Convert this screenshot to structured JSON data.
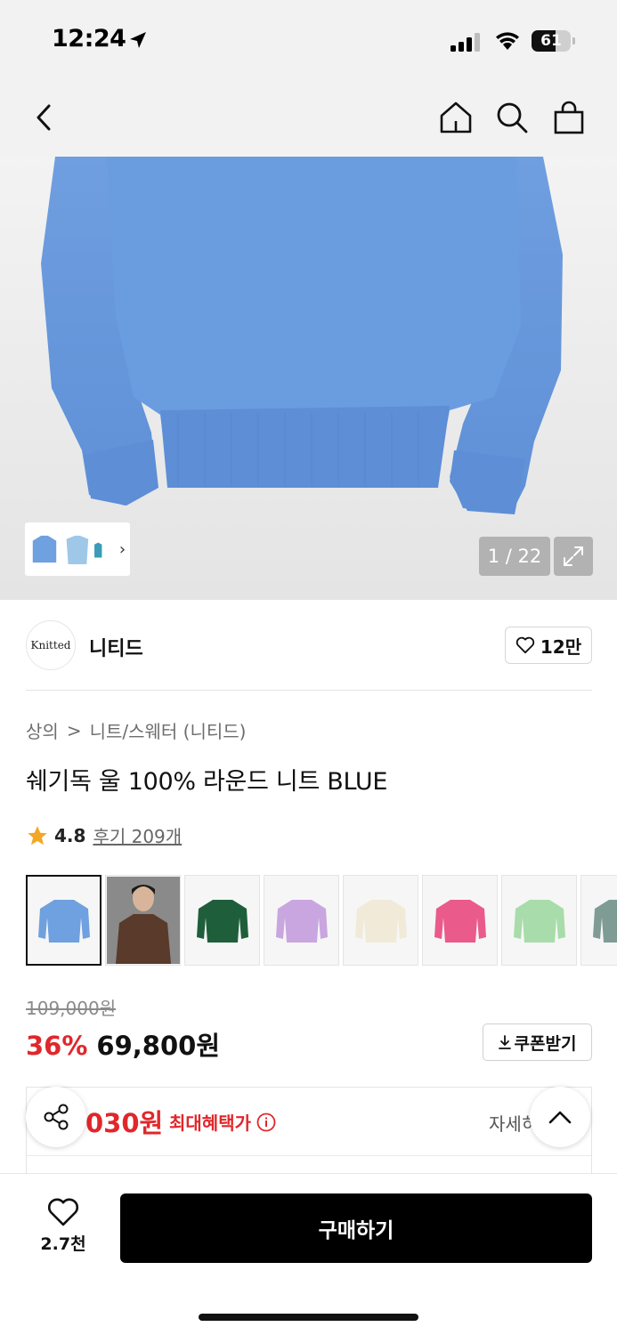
{
  "status_bar": {
    "time": "12:24",
    "battery": "61",
    "battery_level": 0.61
  },
  "nav": {
    "back_icon": "chevron-left-icon",
    "home_icon": "home-icon",
    "search_icon": "search-icon",
    "cart_icon": "shopping-bag-icon"
  },
  "gallery": {
    "counter": "1 / 22",
    "product_color": "#6f9ee0"
  },
  "brand": {
    "logo_text": "Knitted",
    "name": "니티드",
    "like_count": "12만"
  },
  "breadcrumb": {
    "category": "상의",
    "separator": ">",
    "subcategory": "니트/스웨터 (니티드)"
  },
  "product": {
    "title": "쉐기독 울 100% 라운드 니트 BLUE",
    "rating": "4.8",
    "reviews": "후기 209개",
    "star_color": "#f5a623"
  },
  "swatches": [
    {
      "color": "#6fa0df",
      "selected": true
    },
    {
      "color": "#5a3a2a",
      "selected": false
    },
    {
      "color": "#1f5e3a",
      "selected": false
    },
    {
      "color": "#c9a6df",
      "selected": false
    },
    {
      "color": "#f1ead8",
      "selected": false
    },
    {
      "color": "#ea5a8a",
      "selected": false
    },
    {
      "color": "#a8dcaa",
      "selected": false
    },
    {
      "color": "#7f9c94",
      "selected": false
    }
  ],
  "price": {
    "original": "109,000원",
    "discount": "36%",
    "sale": "69,800원",
    "coupon_label": "쿠폰받기",
    "accent_color": "#e0272b"
  },
  "benefit": {
    "price": "030원",
    "label": "최대혜택가",
    "detail": "자세히"
  },
  "bottom": {
    "wish_count": "2.7천",
    "buy_label": "구매하기"
  }
}
